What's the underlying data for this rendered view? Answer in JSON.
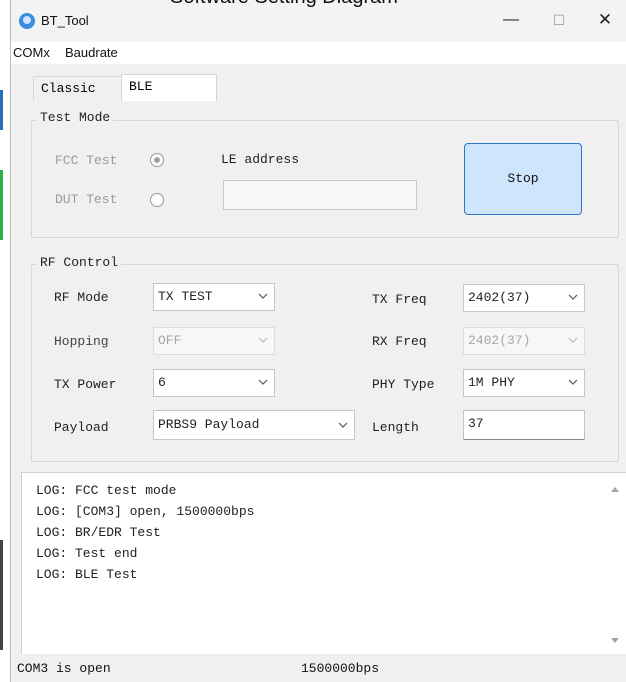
{
  "caption": "Software Setting Diagram",
  "window": {
    "title": "BT_Tool",
    "minimize_glyph": "—",
    "maximize_glyph": "☐",
    "close_glyph": "✕"
  },
  "menu": {
    "items": [
      {
        "label": "COMx"
      },
      {
        "label": "Baudrate"
      }
    ]
  },
  "tabs": {
    "classic": "Classic",
    "ble": "BLE",
    "selected": "BLE"
  },
  "test_mode": {
    "title": "Test Mode",
    "fcc_label": "FCC Test",
    "dut_label": "DUT Test",
    "fcc_checked": true,
    "dut_checked": false,
    "le_address_label": "LE address",
    "le_address_value": "",
    "stop_label": "Stop"
  },
  "rf_control": {
    "title": "RF Control",
    "rf_mode": {
      "label": "RF Mode",
      "value": "TX TEST"
    },
    "hopping": {
      "label": "Hopping",
      "value": "OFF"
    },
    "tx_power": {
      "label": "TX Power",
      "value": "6"
    },
    "payload": {
      "label": "Payload",
      "value": "PRBS9 Payload"
    },
    "tx_freq": {
      "label": "TX Freq",
      "value": "2402(37)"
    },
    "rx_freq": {
      "label": "RX Freq",
      "value": "2402(37)"
    },
    "phy_type": {
      "label": "PHY Type",
      "value": "1M PHY"
    },
    "length": {
      "label": "Length",
      "value": "37"
    }
  },
  "log": {
    "lines": [
      "LOG: FCC test mode",
      "LOG: [COM3] open, 1500000bps",
      "LOG: BR/EDR Test",
      "LOG: Test end",
      "LOG: BLE Test"
    ]
  },
  "status": {
    "port": "COM3 is open",
    "baud": "1500000bps"
  },
  "colors": {
    "accent": "#2e77c9",
    "button_fill": "#cfe5fb",
    "window_bg": "#f0f0f0"
  }
}
